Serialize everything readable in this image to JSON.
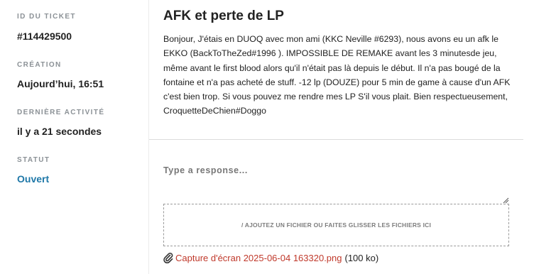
{
  "ticket": {
    "id_label": "ID DU TICKET",
    "id_value": "#114429500",
    "created_label": "CRÉATION",
    "created_value": "Aujourd’hui, 16:51",
    "last_activity_label": "DERNIÈRE ACTIVITÉ",
    "last_activity_value": "il y a 21 secondes",
    "status_label": "STATUT",
    "status_value": "Ouvert"
  },
  "message": {
    "title": "AFK et perte de LP",
    "body": "Bonjour, J'étais en DUOQ avec mon ami (KKC Neville #6293), nous avons eu un afk le EKKO (BackToTheZed#1996 ). IMPOSSIBLE DE REMAKE avant les 3 minutesde jeu, même avant le first blood alors qu'il n'était pas là depuis le début. Il n'a pas bougé de la fontaine et n'a pas acheté de stuff. -12 lp (DOUZE) pour 5 min de game à cause d'un AFK c'est bien trop. Si vous pouvez me rendre mes LP S'il vous plait. Bien respectueusement, CroquetteDeChien#Doggo"
  },
  "reply": {
    "placeholder": "Type a response...",
    "value": ""
  },
  "dropzone": {
    "label": "/ AJOUTEZ UN FICHIER OU FAITES GLISSER LES FICHIERS ICI"
  },
  "attachment": {
    "icon": "paperclip-icon",
    "filename": "Capture d'écran 2025-06-04 163320.png",
    "size": "(100 ko)"
  },
  "colors": {
    "status": "#1f78a8",
    "link": "#c0392b",
    "muted_label": "#8b9196"
  }
}
